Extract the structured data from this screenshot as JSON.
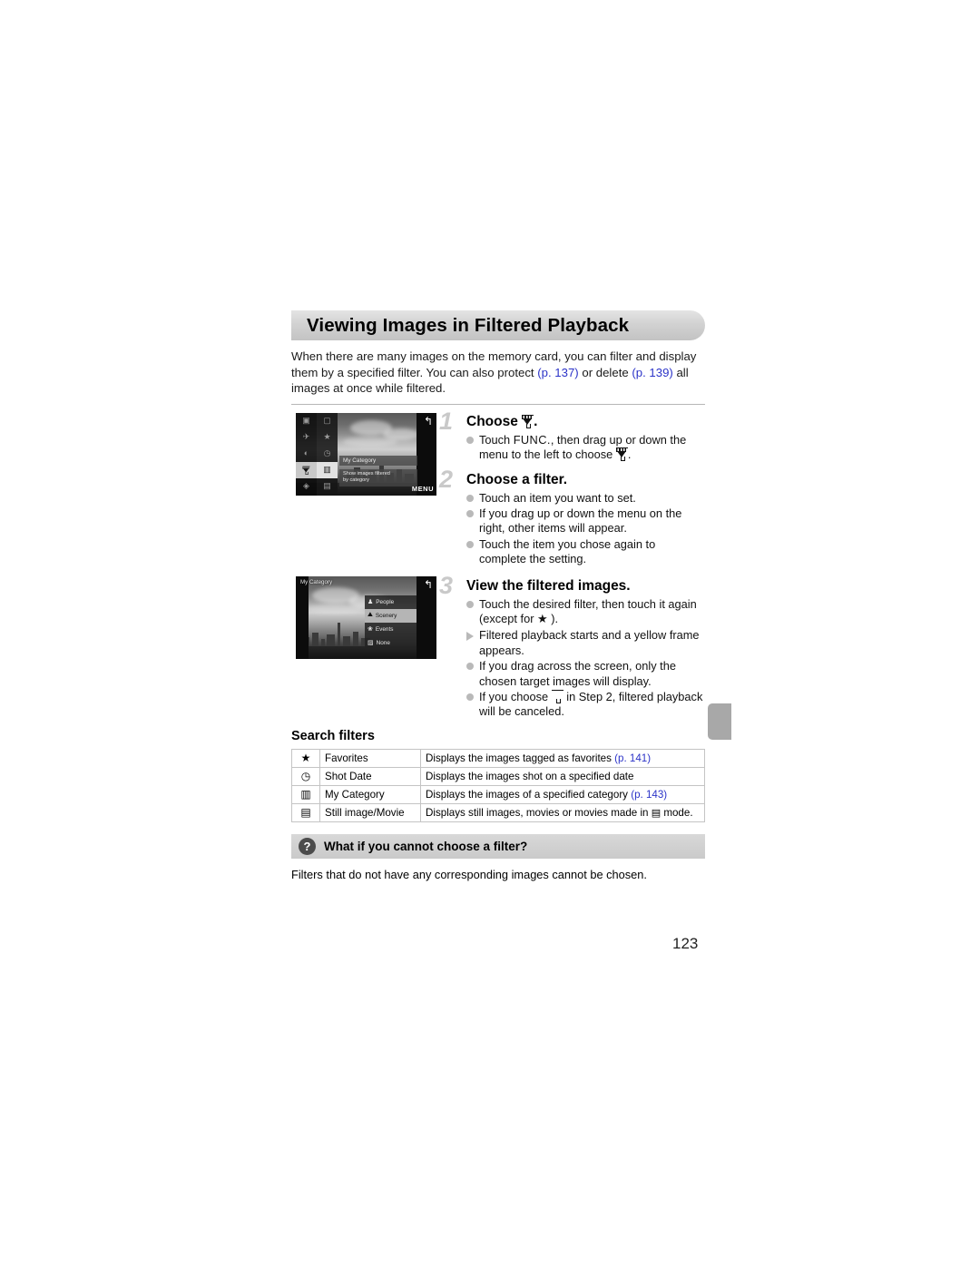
{
  "page": {
    "number": "123"
  },
  "section": {
    "title": "Viewing Images in Filtered Playback",
    "intro_1": "When there are many images on the memory card, you can filter and display them by a specified filter. You can also protect ",
    "intro_ref_1": "(p. 137)",
    "intro_2": " or delete ",
    "intro_ref_2": "(p. 139)",
    "intro_3": " all images at once while filtered."
  },
  "steps": [
    {
      "num": "1",
      "title_pre": "Choose ",
      "title_post": ".",
      "bullets": [
        {
          "type": "dot",
          "text_pre": "Touch ",
          "emph": "FUNC.",
          "text_mid": ", then drag up or down the menu to the left to choose ",
          "text_post": "."
        }
      ]
    },
    {
      "num": "2",
      "title_pre": "Choose a filter.",
      "title_post": "",
      "bullets": [
        {
          "type": "dot",
          "text_pre": "Touch an item you want to set."
        },
        {
          "type": "dot",
          "text_pre": "If you drag up or down the menu on the right, other items will appear."
        },
        {
          "type": "dot",
          "text_pre": "Touch the item you chose again to complete the setting."
        }
      ]
    },
    {
      "num": "3",
      "title_pre": "View the filtered images.",
      "title_post": "",
      "bullets": [
        {
          "type": "dot",
          "text_pre": "Touch the desired filter, then touch it again (except for ",
          "text_post": " )."
        },
        {
          "type": "tri",
          "text_pre": "Filtered playback starts and a yellow frame appears."
        },
        {
          "type": "dot",
          "text_pre": "If you drag across the screen, only the chosen target images will display."
        },
        {
          "type": "dot",
          "text_pre": "If you choose ",
          "text_post": " in Step 2, filtered playback will be canceled."
        }
      ]
    }
  ],
  "figure1": {
    "tip_title": "My Category",
    "tip_line1": "Show images filtered",
    "tip_line2": "by category",
    "menu_button": "MENU",
    "return_icon": "return-arrow-icon"
  },
  "figure2": {
    "title": "My Category",
    "menu": [
      {
        "label": "People",
        "icon": "people-icon",
        "selected": false
      },
      {
        "label": "Scenery",
        "icon": "scenery-icon",
        "selected": true
      },
      {
        "label": "Events",
        "icon": "events-icon",
        "selected": false
      },
      {
        "label": "None",
        "icon": "none-icon",
        "selected": false
      }
    ],
    "return_icon": "return-arrow-icon"
  },
  "search_filters": {
    "heading": "Search filters",
    "rows": [
      {
        "icon": "★",
        "icon_name": "star-icon",
        "name": "Favorites",
        "desc": "Displays the images tagged as favorites ",
        "ref": "(p. 141)",
        "desc_after": ""
      },
      {
        "icon": "◷",
        "icon_name": "clock-icon",
        "name": "Shot Date",
        "desc": "Displays the images shot on a specified date",
        "ref": "",
        "desc_after": ""
      },
      {
        "icon": "▥",
        "icon_name": "category-icon",
        "name": "My Category",
        "desc": "Displays the images of a specified category ",
        "ref": "(p. 143)",
        "desc_after": ""
      },
      {
        "icon": "▤",
        "icon_name": "still-movie-icon",
        "name": "Still image/Movie",
        "desc": "Displays still images, movies or movies made in ",
        "ref": "",
        "desc_after": " mode."
      }
    ]
  },
  "callout": {
    "icon": "?",
    "title": "What if you cannot choose a filter?",
    "body": "Filters that do not have any corresponding images cannot be chosen."
  }
}
